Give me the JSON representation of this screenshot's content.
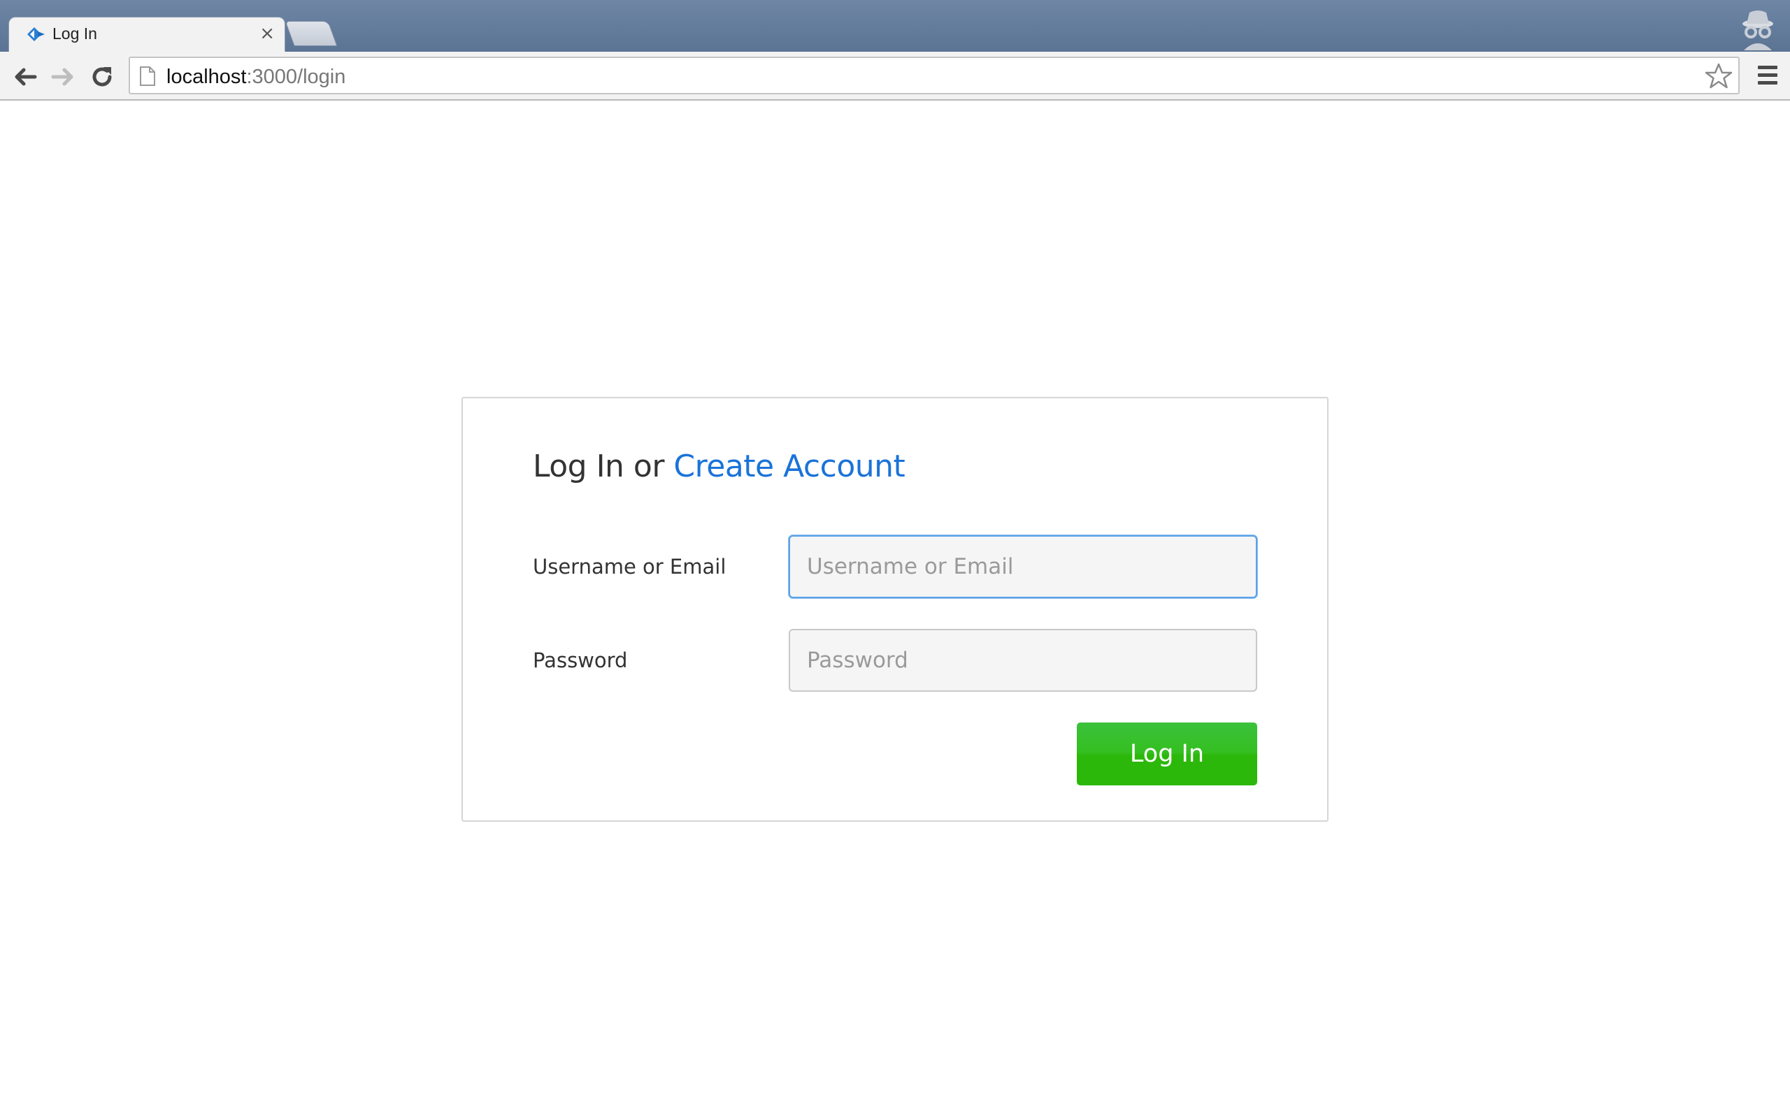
{
  "browser": {
    "tab": {
      "title": "Log In",
      "close_glyph": "×",
      "favicon": "diamond-arrows-icon"
    },
    "url": {
      "host": "localhost",
      "path": ":3000/login"
    },
    "icons": {
      "back": "back-arrow-icon",
      "forward": "forward-arrow-icon",
      "reload": "reload-icon",
      "page": "page-icon",
      "bookmark": "star-icon",
      "menu": "hamburger-menu-icon",
      "incognito": "incognito-icon"
    }
  },
  "login": {
    "title_prefix": "Log In or ",
    "create_account_link": "Create Account",
    "username_label": "Username or Email",
    "username_placeholder": "Username or Email",
    "username_value": "",
    "password_label": "Password",
    "password_placeholder": "Password",
    "password_value": "",
    "submit_label": "Log In"
  },
  "colors": {
    "link": "#1a73d9",
    "button": "#2cb80a",
    "focus_border": "#5aa2e8"
  }
}
